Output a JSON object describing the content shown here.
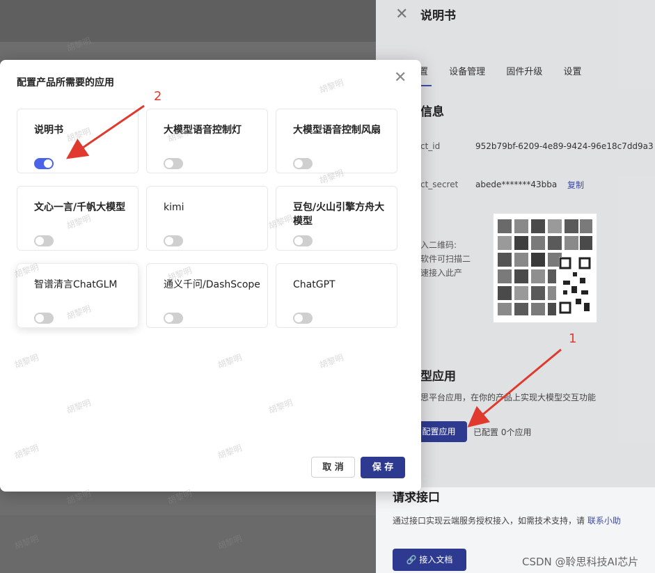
{
  "panel": {
    "title": "说明书",
    "tabs": [
      "置",
      "设备管理",
      "固件升级",
      "设置"
    ],
    "section_info": "信息",
    "fields": [
      {
        "label": "ct_id",
        "value": "952b79bf-6209-4e89-9424-96e18c7dd9a3"
      },
      {
        "label": "ct_secret",
        "value": "abede*******43bba"
      }
    ],
    "copy_label": "复制",
    "qr_note": [
      "入二维码:",
      "软件可扫描二",
      "速接入此产"
    ],
    "section_model": "型应用",
    "model_desc": "思平台应用，在你的产品上实现大模型交互功能",
    "config_button": "配置应用",
    "config_count": "已配置 0个应用",
    "section_api": "请求接口",
    "api_desc": "通过接口实现云端服务授权接入，如需技术支持，请",
    "api_link": "联系小助",
    "doc_button": "接入文档"
  },
  "modal": {
    "title": "配置产品所需要的应用",
    "cards": [
      {
        "name": "说明书",
        "on": true
      },
      {
        "name": "大模型语音控制灯",
        "on": false
      },
      {
        "name": "大模型语音控制风扇",
        "on": false
      },
      {
        "name": "文心一言/千帆大模型",
        "on": false
      },
      {
        "name": "kimi",
        "on": false
      },
      {
        "name": "豆包/火山引擎方舟大模型",
        "on": false
      },
      {
        "name": "智谱清言ChatGLM",
        "on": false
      },
      {
        "name": "通义千问/DashScope",
        "on": false
      },
      {
        "name": "ChatGPT",
        "on": false
      }
    ],
    "cancel": "取 消",
    "save": "保 存"
  },
  "annotations": {
    "one": "1",
    "two": "2",
    "color": "#e03a2f"
  },
  "watermark": "胡黎明",
  "footer_credit": "CSDN @聆思科技AI芯片",
  "colors": {
    "accent": "#2e3a8f",
    "toggle_on": "#4b63e8"
  }
}
